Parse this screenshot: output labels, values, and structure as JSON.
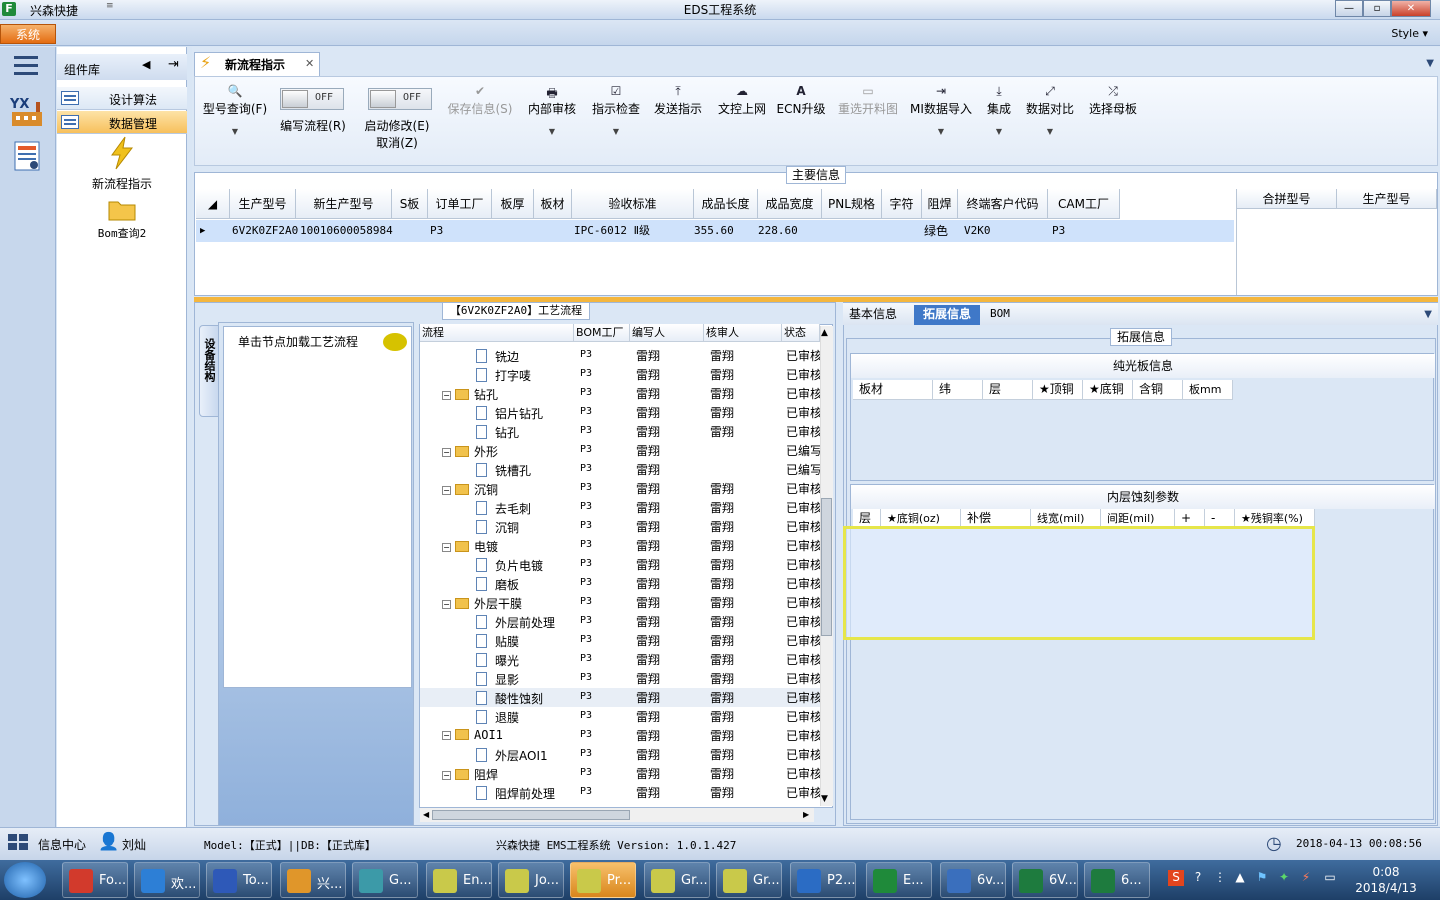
{
  "titlebar": {
    "app_name": "兴森快捷",
    "qa_arrow": "≡",
    "window_title": "EDS工程系统",
    "min": "—",
    "max": "▫",
    "close": "✕"
  },
  "menu": {
    "system_tab": "系统",
    "style_label": "Style ▾"
  },
  "leftstrip": {
    "yx_label": "YX"
  },
  "complib": {
    "title": "组件库",
    "items": [
      {
        "label": "设计算法"
      },
      {
        "label": "数据管理"
      }
    ],
    "icons": [
      {
        "label": "新流程指示"
      },
      {
        "label": "Bom查询2"
      }
    ]
  },
  "doc_tab": {
    "label": "新流程指示"
  },
  "ribbon": {
    "buttons": [
      {
        "label": "型号查询(F)",
        "icon": "🔍"
      },
      {
        "label": "保存信息(S)",
        "icon": "✔"
      },
      {
        "label": "内部审核",
        "icon": "🖶"
      },
      {
        "label": "指示检查",
        "icon": "☑"
      },
      {
        "label": "发送指示",
        "icon": "⤒"
      },
      {
        "label": "文控上网",
        "icon": "☁"
      },
      {
        "label": "ECN升级",
        "icon": "A"
      },
      {
        "label": "重选开料图",
        "icon": "▭"
      },
      {
        "label": "MI数据导入",
        "icon": "⇥"
      },
      {
        "label": "集成",
        "icon": "⤓"
      },
      {
        "label": "数据对比",
        "icon": "⤢"
      },
      {
        "label": "选择母板",
        "icon": "⤮"
      }
    ],
    "toggles": [
      {
        "state": "OFF",
        "label": "编写流程(R)"
      },
      {
        "state": "OFF",
        "label": "启动修改(E)",
        "label2": "取消(Z)"
      }
    ]
  },
  "maininfo": {
    "title": "主要信息",
    "columns": [
      "生产型号",
      "新生产型号",
      "S板",
      "订单工厂",
      "板厚",
      "板材",
      "验收标准",
      "成品长度",
      "成品宽度",
      "PNL规格",
      "字符",
      "阻焊",
      "终端客户代码",
      "CAM工厂"
    ],
    "row": [
      "6V2K0ZF2A0",
      "10010600058984",
      "",
      "P3",
      "",
      "",
      "IPC-6012 Ⅱ级",
      "355.60",
      "228.60",
      "",
      "",
      "绿色",
      "V2K0",
      "P3"
    ],
    "merge_columns": [
      "合拼型号",
      "生产型号"
    ]
  },
  "process": {
    "title": "【6V2K0ZF2A0】工艺流程",
    "side_tab": "设备结构",
    "device_hint": "单击节点加载工艺流程",
    "columns": [
      "流程",
      "BOM工厂",
      "编写人",
      "核审人",
      "状态"
    ],
    "rows": [
      {
        "name": "铣边",
        "type": "doc",
        "bom": "P3",
        "writer": "雷翔",
        "reviewer": "雷翔",
        "status": "已审核"
      },
      {
        "name": "打字唛",
        "type": "doc",
        "bom": "P3",
        "writer": "雷翔",
        "reviewer": "雷翔",
        "status": "已审核"
      },
      {
        "name": "钻孔",
        "type": "folder",
        "bom": "P3",
        "writer": "雷翔",
        "reviewer": "雷翔",
        "status": "已审核"
      },
      {
        "name": "铝片钻孔",
        "type": "doc",
        "bom": "P3",
        "writer": "雷翔",
        "reviewer": "雷翔",
        "status": "已审核"
      },
      {
        "name": "钻孔",
        "type": "doc",
        "bom": "P3",
        "writer": "雷翔",
        "reviewer": "雷翔",
        "status": "已审核"
      },
      {
        "name": "外形",
        "type": "folder",
        "bom": "P3",
        "writer": "雷翔",
        "reviewer": "",
        "status": "已编写"
      },
      {
        "name": "铣槽孔",
        "type": "doc",
        "bom": "P3",
        "writer": "雷翔",
        "reviewer": "",
        "status": "已编写"
      },
      {
        "name": "沉铜",
        "type": "folder",
        "bom": "P3",
        "writer": "雷翔",
        "reviewer": "雷翔",
        "status": "已审核"
      },
      {
        "name": "去毛刺",
        "type": "doc",
        "bom": "P3",
        "writer": "雷翔",
        "reviewer": "雷翔",
        "status": "已审核"
      },
      {
        "name": "沉铜",
        "type": "doc",
        "bom": "P3",
        "writer": "雷翔",
        "reviewer": "雷翔",
        "status": "已审核"
      },
      {
        "name": "电镀",
        "type": "folder",
        "bom": "P3",
        "writer": "雷翔",
        "reviewer": "雷翔",
        "status": "已审核"
      },
      {
        "name": "负片电镀",
        "type": "doc",
        "bom": "P3",
        "writer": "雷翔",
        "reviewer": "雷翔",
        "status": "已审核"
      },
      {
        "name": "磨板",
        "type": "doc",
        "bom": "P3",
        "writer": "雷翔",
        "reviewer": "雷翔",
        "status": "已审核"
      },
      {
        "name": "外层干膜",
        "type": "folder",
        "bom": "P3",
        "writer": "雷翔",
        "reviewer": "雷翔",
        "status": "已审核"
      },
      {
        "name": "外层前处理",
        "type": "doc",
        "bom": "P3",
        "writer": "雷翔",
        "reviewer": "雷翔",
        "status": "已审核"
      },
      {
        "name": "贴膜",
        "type": "doc",
        "bom": "P3",
        "writer": "雷翔",
        "reviewer": "雷翔",
        "status": "已审核"
      },
      {
        "name": "曝光",
        "type": "doc",
        "bom": "P3",
        "writer": "雷翔",
        "reviewer": "雷翔",
        "status": "已审核"
      },
      {
        "name": "显影",
        "type": "doc",
        "bom": "P3",
        "writer": "雷翔",
        "reviewer": "雷翔",
        "status": "已审核"
      },
      {
        "name": "酸性蚀刻",
        "type": "doc",
        "bom": "P3",
        "writer": "雷翔",
        "reviewer": "雷翔",
        "status": "已审核"
      },
      {
        "name": "退膜",
        "type": "doc",
        "bom": "P3",
        "writer": "雷翔",
        "reviewer": "雷翔",
        "status": "已审核"
      },
      {
        "name": "AOI1",
        "type": "folder",
        "bom": "P3",
        "writer": "雷翔",
        "reviewer": "雷翔",
        "status": "已审核"
      },
      {
        "name": "外层AOI1",
        "type": "doc",
        "bom": "P3",
        "writer": "雷翔",
        "reviewer": "雷翔",
        "status": "已审核"
      },
      {
        "name": "阻焊",
        "type": "folder",
        "bom": "P3",
        "writer": "雷翔",
        "reviewer": "雷翔",
        "status": "已审核"
      },
      {
        "name": "阻焊前处理",
        "type": "doc",
        "bom": "P3",
        "writer": "雷翔",
        "reviewer": "雷翔",
        "status": "已审核"
      }
    ]
  },
  "right": {
    "tabs": [
      "基本信息",
      "拓展信息",
      "BOM"
    ],
    "ext_title": "拓展信息",
    "sec1": {
      "title": "纯光板信息",
      "cols": [
        "板材",
        "纬",
        "层",
        "★顶铜",
        "★底铜",
        "含铜",
        "板mm"
      ]
    },
    "sec2": {
      "title": "内层蚀刻参数",
      "cols": [
        "层",
        "★底铜(oz)",
        "补偿",
        "线宽(mil)",
        "间距(mil)",
        "+",
        "-",
        "★残铜率(%)"
      ]
    }
  },
  "status": {
    "info_center": "信息中心",
    "user": "刘灿",
    "model": "Model:【正式】||DB:【正式库】",
    "version": "兴森快捷 EMS工程系统 Version: 1.0.1.427",
    "datetime": "2018-04-13 00:08:56"
  },
  "taskbar": {
    "items": [
      {
        "label": "Fo...",
        "color": "#d23a2c"
      },
      {
        "label": "欢...",
        "color": "#2d7fd6"
      },
      {
        "label": "To...",
        "color": "#2e59b8"
      },
      {
        "label": "兴...",
        "color": "#e0962a"
      },
      {
        "label": "G...",
        "color": "#3c9aa8"
      },
      {
        "label": "En...",
        "color": "#c9c94a"
      },
      {
        "label": "Jo...",
        "color": "#c9c94a"
      },
      {
        "label": "Pr...",
        "color": "#c9c94a"
      },
      {
        "label": "Gr...",
        "color": "#c9c94a"
      },
      {
        "label": "Gr...",
        "color": "#c9c94a"
      },
      {
        "label": "P2...",
        "color": "#2b6cc4"
      },
      {
        "label": "E...",
        "color": "#1f8a3a"
      },
      {
        "label": "6v...",
        "color": "#3a6fbd"
      },
      {
        "label": "6V...",
        "color": "#1e7b3e"
      },
      {
        "label": "6...",
        "color": "#1e7b3e"
      }
    ],
    "clock_time": "0:08",
    "clock_date": "2018/4/13"
  }
}
